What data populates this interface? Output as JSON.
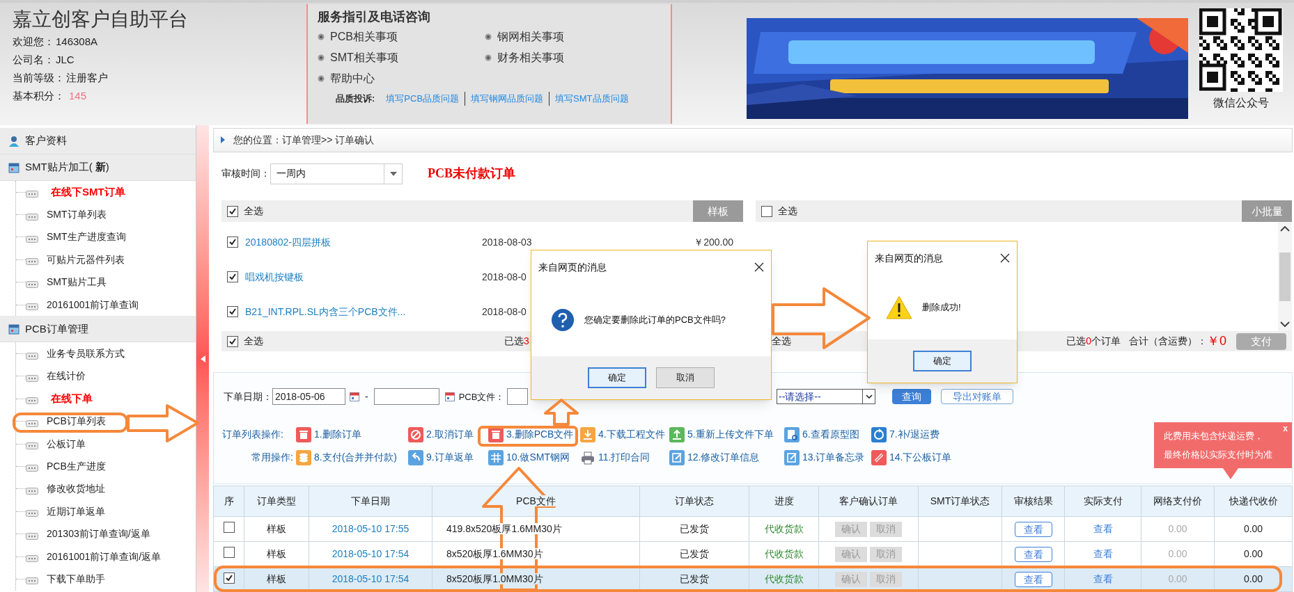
{
  "header": {
    "title": "嘉立创客户自助平台",
    "account_lines": [
      {
        "label": "欢迎您：",
        "value": "146308A",
        "kind": "plain"
      },
      {
        "label": "公司名：",
        "value": "JLC",
        "kind": "plain"
      },
      {
        "label": "当前等级：",
        "value": "注册客户",
        "kind": "plain"
      },
      {
        "label": "基本积分：",
        "value": "145",
        "kind": "points"
      }
    ]
  },
  "service_guide": {
    "title": "服务指引及电话咨询",
    "links": [
      "PCB相关事项",
      "钢网相关事项",
      "SMT相关事项",
      "财务相关事项",
      "帮助中心"
    ],
    "complaint_label": "品质投诉:",
    "complaint_links": [
      "填写PCB品质问题",
      "填写钢网品质问题",
      "填写SMT品质问题"
    ]
  },
  "qr": {
    "caption": "微信公众号"
  },
  "sidebar": {
    "groups": [
      {
        "label": "客户资料",
        "kind": "person"
      },
      {
        "label": "SMT贴片加工( **新**)",
        "kind": "calendar",
        "children": [
          {
            "label": "在线下SMT订单",
            "highlight": true
          },
          {
            "label": "SMT订单列表",
            "highlight": false
          },
          {
            "label": "SMT生产进度查询",
            "highlight": false
          },
          {
            "label": "可贴片元器件列表",
            "highlight": false
          },
          {
            "label": "SMT贴片工具",
            "highlight": false
          },
          {
            "label": "20161001前订单查询",
            "highlight": false
          }
        ]
      },
      {
        "label": "PCB订单管理",
        "kind": "calendar",
        "children": [
          {
            "label": "业务专员联系方式",
            "highlight": false
          },
          {
            "label": "在线计价",
            "highlight": false
          },
          {
            "label": "在线下单",
            "highlight": true
          },
          {
            "label": "PCB订单列表",
            "highlight": false
          },
          {
            "label": "公板订单",
            "highlight": false
          },
          {
            "label": "PCB生产进度",
            "highlight": false
          },
          {
            "label": "修改收货地址",
            "highlight": false
          },
          {
            "label": "近期订单返单",
            "highlight": false
          },
          {
            "label": "201303前订单查询/返单",
            "highlight": false
          },
          {
            "label": "20161001前订单查询/返单",
            "highlight": false
          },
          {
            "label": "下载下单助手",
            "highlight": false
          }
        ]
      }
    ]
  },
  "breadcrumb": "您的位置：订单管理>> 订单确认",
  "review_filter": {
    "label": "审核时间：",
    "value": "一周内"
  },
  "section_title": "PCB未付款订单",
  "sample_panel": {
    "select_all_label": "全选",
    "select_all_checked": true,
    "tab": "样板",
    "orders": [
      {
        "name": "20180802-四层拼板",
        "date": "2018-08-03",
        "price": "￥200.00",
        "checked": true
      },
      {
        "name": "唱戏机按键板",
        "date": "2018-08-0",
        "checked": true
      },
      {
        "name": "B21_INT.RPL.SL内含三个PCB文件...",
        "date": "2018-08-0",
        "checked": true
      }
    ],
    "footer": {
      "select_all_label": "全选",
      "select_all_checked": true,
      "selected_prefix": "已选",
      "selected_count": "3"
    }
  },
  "small_batch_panel": {
    "select_all_label": "全选",
    "select_all_checked": false,
    "tab": "小批量",
    "footer": {
      "select_all_label": "全选",
      "selected_prefix": "已选",
      "selected_count": "0",
      "selected_suffix": "个订单",
      "total_label": "合计（含运费）：",
      "total": "￥0",
      "pay_button": "支付"
    }
  },
  "order_filter": {
    "date_label": "下单日期：",
    "date_from": "2018-05-06",
    "date_sep": "-",
    "file_label": "PCB文件：",
    "status_select": "--请选择--",
    "search_button": "查询",
    "export_button": "导出对账单"
  },
  "toolbar": {
    "rows": [
      {
        "label": "订单列表操作:",
        "actions": [
          "1.删除订单",
          "2.取消订单",
          "3.删除PCB文件",
          "4.下载工程文件",
          "5.重新上传文件下单",
          "6.查看原型图",
          "7.补/退运费"
        ]
      },
      {
        "label": "常用操作:",
        "actions": [
          "8.支付(合并并付款)",
          "9.订单返单",
          "10.做SMT钢网",
          "11.打印合同",
          "12.修改订单信息",
          "13.订单备忘录",
          "14.下公板订单"
        ]
      }
    ]
  },
  "fee_tip": {
    "lines": [
      "此费用未包含快递运费，",
      "最终价格以实际支付时为准"
    ],
    "close": "x"
  },
  "orders_table": {
    "columns": [
      "序",
      "订单类型",
      "下单日期",
      "PCB文件",
      "订单状态",
      "进度",
      "客户确认订单",
      "SMT订单状态",
      "审核结果",
      "实际支付",
      "网络支付价",
      "快递代收价"
    ],
    "rows": [
      {
        "checked": false,
        "type": "样板",
        "date": "2018-05-10 17:55",
        "pcb_file": "419.8x520板厚1.6MM30片",
        "status": "已发货",
        "progress": "代收货款",
        "confirm": "确认",
        "cancel": "取消",
        "review": "查看",
        "payment": "查看",
        "online_price": "0.00",
        "courier_price": "0.00"
      },
      {
        "checked": false,
        "type": "样板",
        "date": "2018-05-10 17:54",
        "pcb_file": "8x520板厚1.6MM30片",
        "status": "已发货",
        "progress": "代收货款",
        "confirm": "确认",
        "cancel": "取消",
        "review": "查看",
        "payment": "查看",
        "online_price": "0.00",
        "courier_price": "0.00"
      },
      {
        "checked": true,
        "type": "样板",
        "date": "2018-05-10 17:54",
        "pcb_file": "8x520板厚1.0MM30片",
        "status": "已发货",
        "progress": "代收货款",
        "confirm": "确认",
        "cancel": "取消",
        "review": "查看",
        "payment": "查看",
        "online_price": "0.00",
        "courier_price": "0.00"
      }
    ]
  },
  "dialogs": [
    {
      "title": "来自网页的消息",
      "kind": "question",
      "message": "您确定要删除此订单的PCB文件吗?",
      "buttons": [
        "确定",
        "取消"
      ]
    },
    {
      "title": "来自网页的消息",
      "kind": "warning",
      "message": "删除成功!",
      "buttons": [
        "确定"
      ]
    }
  ]
}
